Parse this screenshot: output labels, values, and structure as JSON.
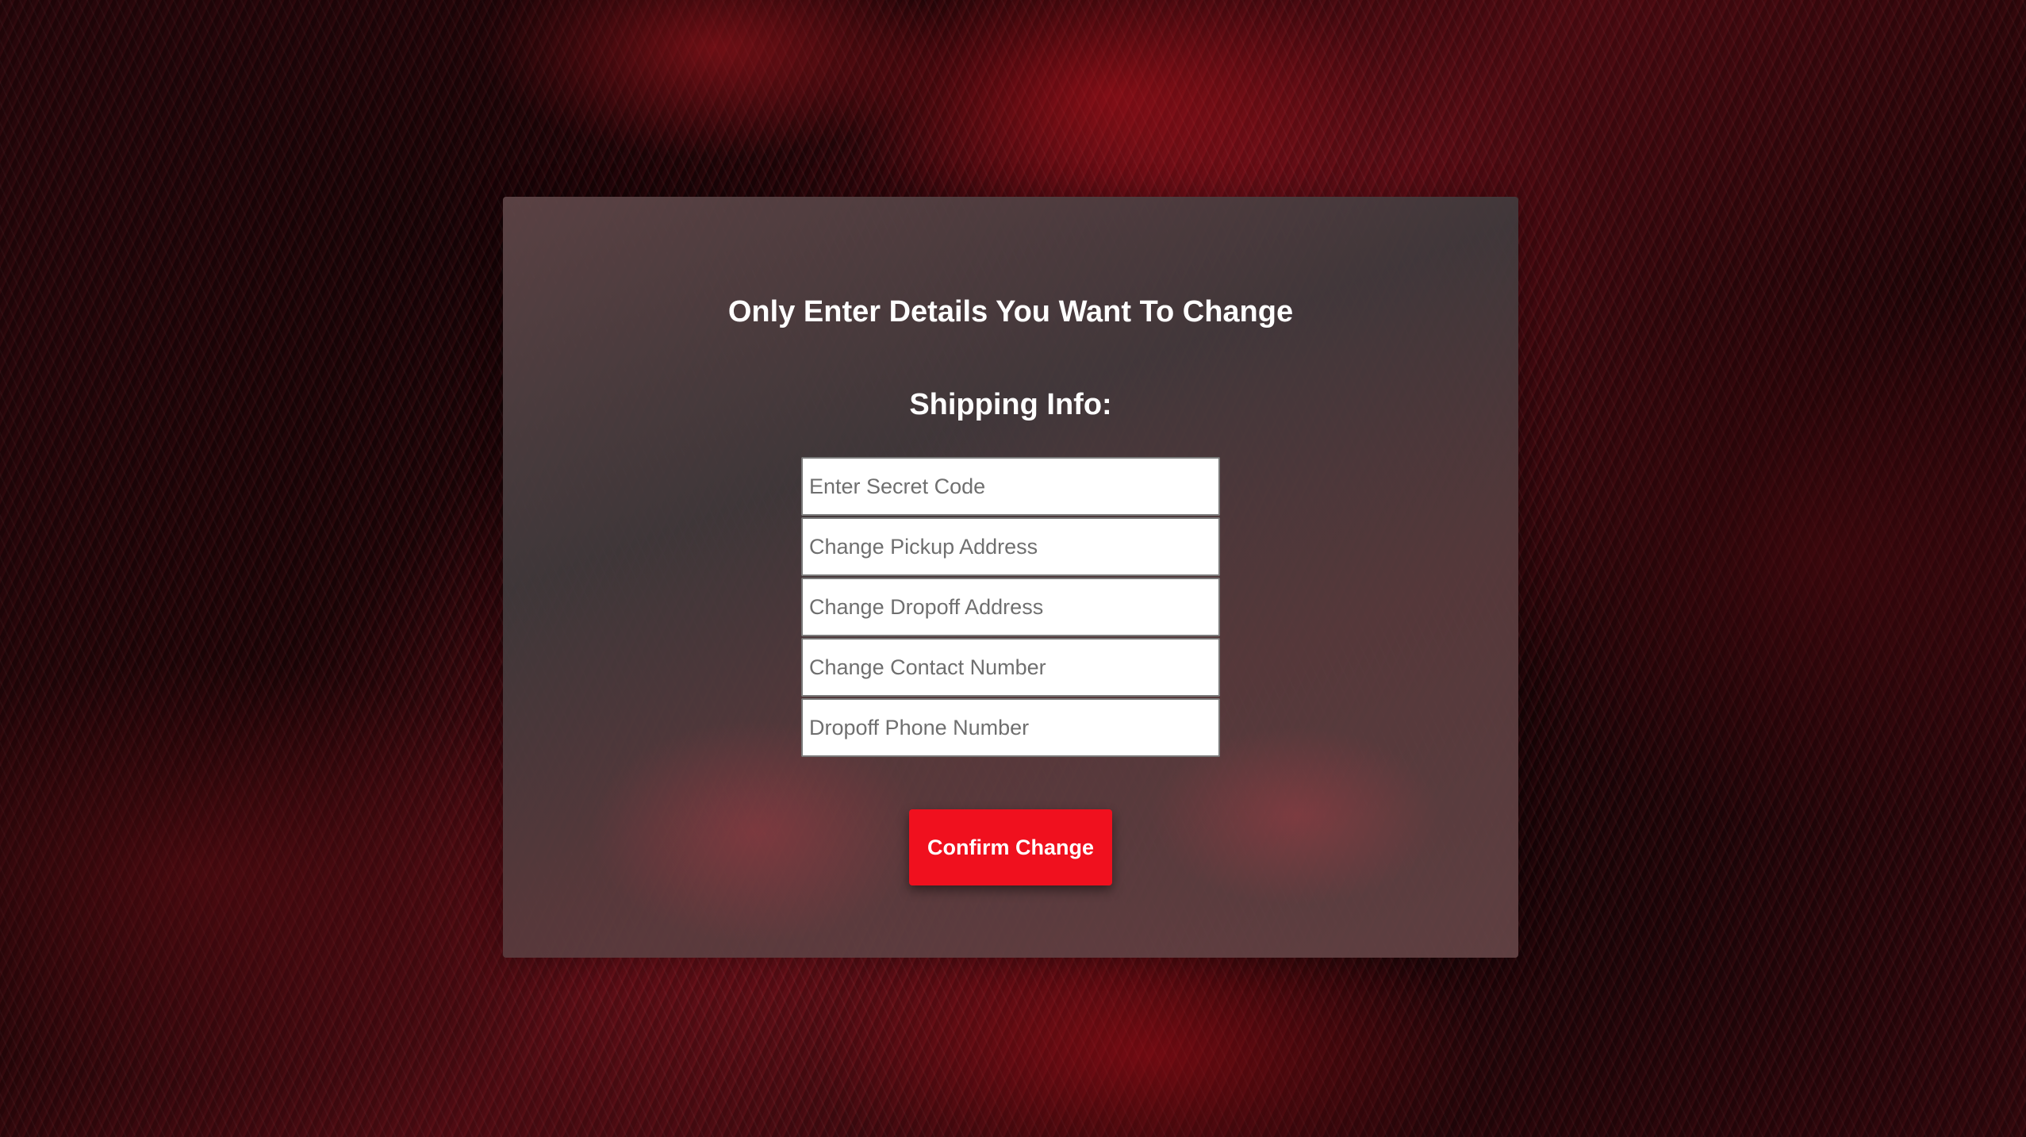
{
  "page": {
    "heading": "Only Enter Details You Want To Change",
    "subheading": "Shipping Info:"
  },
  "form": {
    "fields": [
      {
        "placeholder": "Enter Secret Code",
        "value": ""
      },
      {
        "placeholder": "Change Pickup Address",
        "value": ""
      },
      {
        "placeholder": "Change Dropoff Address",
        "value": ""
      },
      {
        "placeholder": "Change Contact Number",
        "value": ""
      },
      {
        "placeholder": "Dropoff Phone Number",
        "value": ""
      }
    ],
    "confirm_label": "Confirm Change"
  },
  "colors": {
    "accent": "#f0101e",
    "background": "#3a0a10"
  }
}
